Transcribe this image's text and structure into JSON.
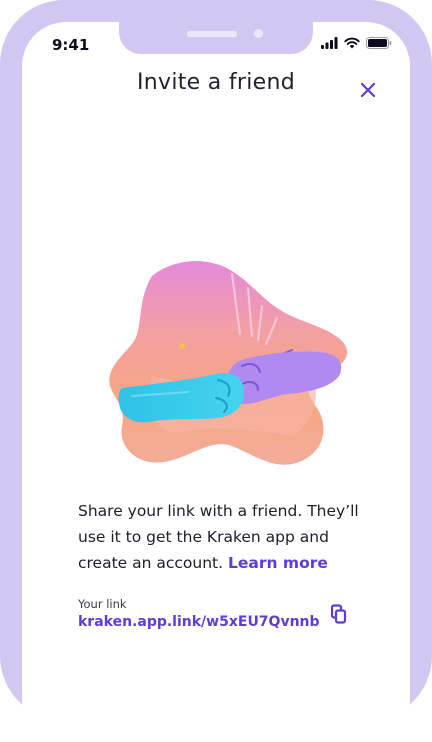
{
  "status_bar": {
    "time": "9:41"
  },
  "header": {
    "title": "Invite a friend",
    "close_icon": "close-icon"
  },
  "illustration": {
    "icon": "fist-bump-illustration"
  },
  "description": {
    "text": "Share your link with a friend. They’ll use it to get the Kraken app and create an account.",
    "learn_more": "Learn more"
  },
  "link": {
    "label": "Your link",
    "value": "kraken.app.link/w5xEU7Qvnnb",
    "copy_icon": "copy-icon"
  },
  "colors": {
    "accent": "#5e3dd3",
    "frame": "#d2c7f1",
    "text": "#201d2b"
  }
}
